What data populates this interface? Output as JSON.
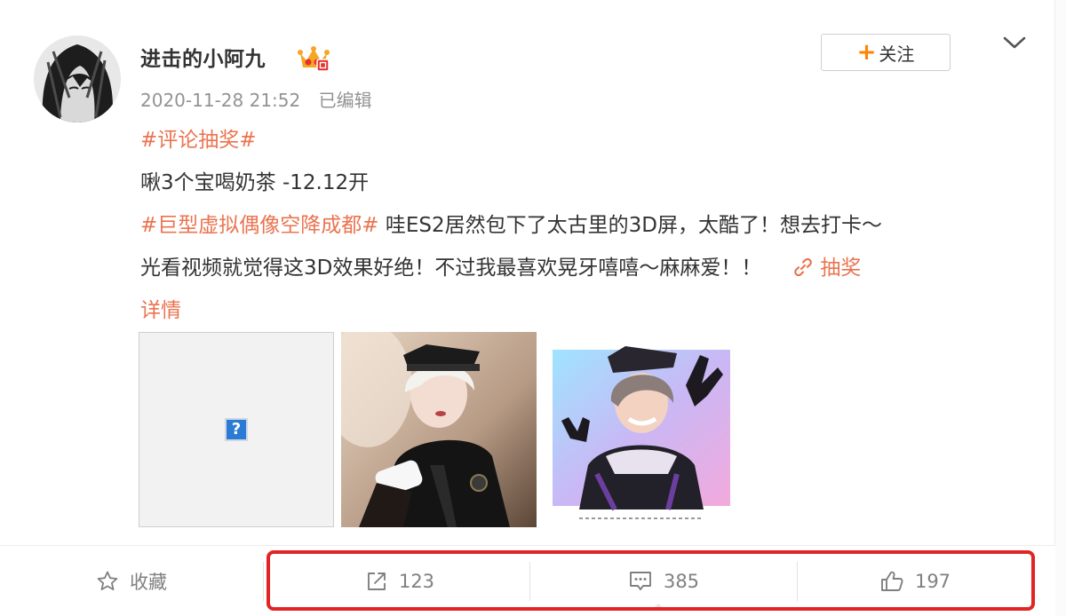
{
  "post": {
    "author": "进击的小阿九",
    "timestamp": "2020-11-28 21:52",
    "edited_label": "已编辑",
    "follow_label": "关注",
    "follow_plus": "+",
    "topic_1": "#评论抽奖#",
    "line_2": "啾3个宝喝奶茶 -12.12开",
    "topic_2": "#巨型虚拟偶像空降成都#",
    "line_3_text": " 哇ES2居然包下了太古里的3D屏，太酷了！想去打卡～",
    "line_4_text": "光看视频就觉得这3D效果好绝！不过我最喜欢晃牙嘻嘻～麻麻爱！！",
    "lottery_link": "抽奖",
    "details_link": "详情",
    "broken_image_glyph": "?"
  },
  "actions": {
    "favorite_label": "收藏",
    "share_count": "123",
    "comment_count": "385",
    "like_count": "197"
  },
  "colors": {
    "topic": "#eb7350",
    "follow_plus": "#ff8200",
    "highlight_box": "#e12424",
    "vip_crown": "#f5a623"
  },
  "icons": {
    "vip_badge": "crown-badge-icon",
    "more": "chevron-down-icon",
    "link": "link-icon",
    "favorite": "star-icon",
    "share": "share-icon",
    "comment": "comment-icon",
    "like": "thumbs-up-icon",
    "broken_image": "broken-image-icon"
  }
}
